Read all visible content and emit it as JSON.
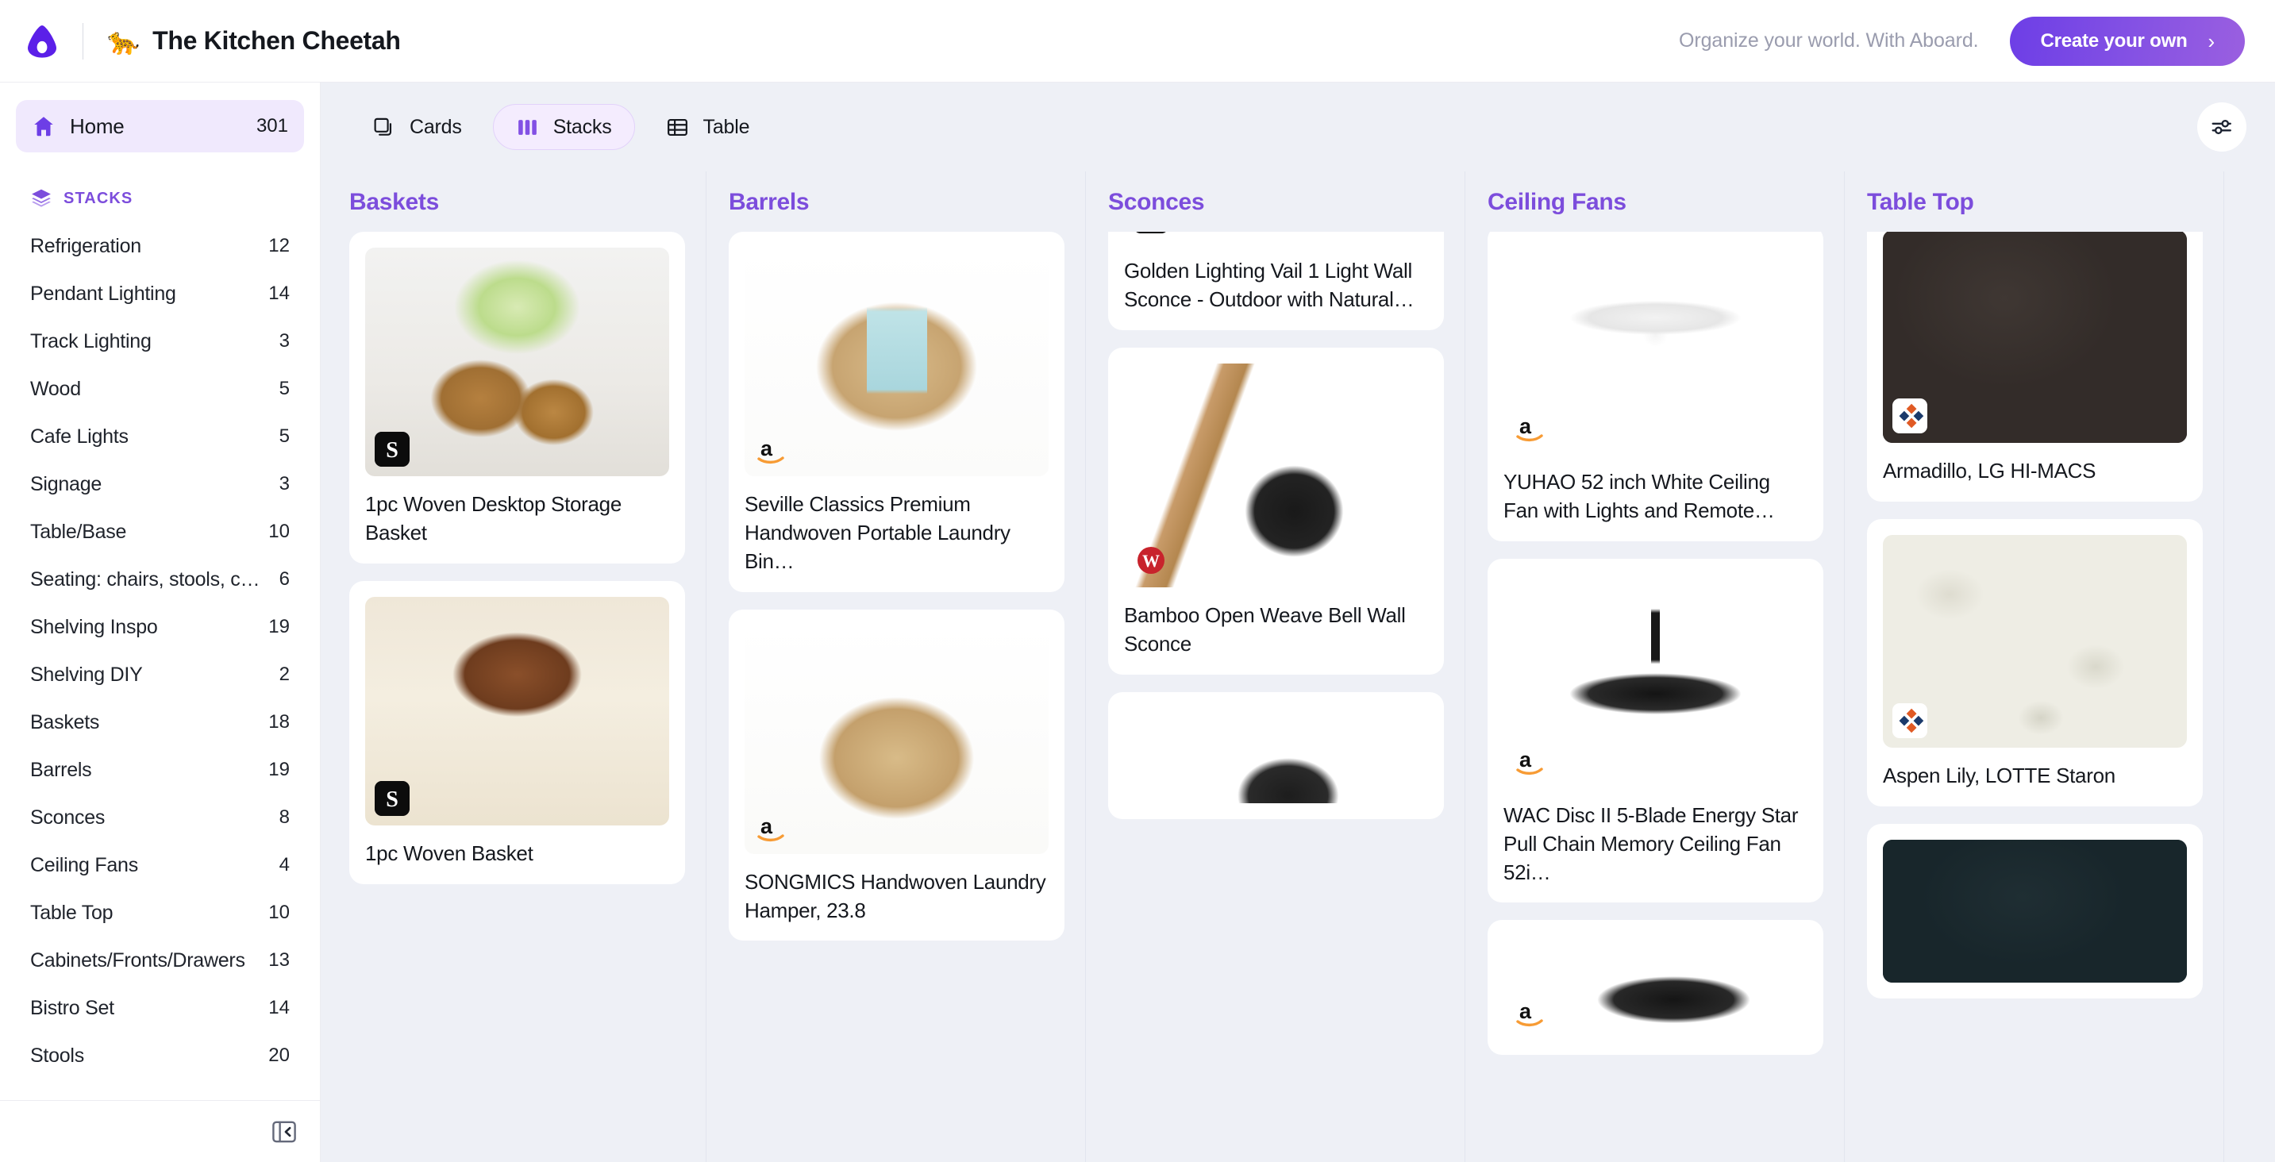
{
  "header": {
    "logo_icon": "aboard-logo-icon",
    "board_emoji": "🐆",
    "board_title": "The Kitchen Cheetah",
    "tagline": "Organize your world. With Aboard.",
    "cta_label": "Create your own",
    "cta_chevron": "›",
    "cta_color": "#8250e4"
  },
  "sidebar": {
    "home": {
      "label": "Home",
      "count": "301",
      "icon": "home-icon"
    },
    "section": {
      "label": "STACKS",
      "icon": "stacks-layers-icon",
      "color": "#7c4ddc"
    },
    "items": [
      {
        "label": "Refrigeration",
        "count": "12"
      },
      {
        "label": "Pendant Lighting",
        "count": "14"
      },
      {
        "label": "Track Lighting",
        "count": "3"
      },
      {
        "label": "Wood",
        "count": "5"
      },
      {
        "label": "Cafe Lights",
        "count": "5"
      },
      {
        "label": "Signage",
        "count": "3"
      },
      {
        "label": "Table/Base",
        "count": "10"
      },
      {
        "label": "Seating: chairs, stools, ch…",
        "count": "6"
      },
      {
        "label": "Shelving Inspo",
        "count": "19"
      },
      {
        "label": "Shelving DIY",
        "count": "2"
      },
      {
        "label": "Baskets",
        "count": "18"
      },
      {
        "label": "Barrels",
        "count": "19"
      },
      {
        "label": "Sconces",
        "count": "8"
      },
      {
        "label": "Ceiling Fans",
        "count": "4"
      },
      {
        "label": "Table Top",
        "count": "10"
      },
      {
        "label": "Cabinets/Fronts/Drawers",
        "count": "13"
      },
      {
        "label": "Bistro Set",
        "count": "14"
      },
      {
        "label": "Stools",
        "count": "20"
      }
    ],
    "collapse_icon": "panel-collapse-left-icon"
  },
  "toolbar": {
    "tabs": [
      {
        "label": "Cards",
        "icon": "cards-icon",
        "active": false
      },
      {
        "label": "Stacks",
        "icon": "stacks-columns-icon",
        "active": true
      },
      {
        "label": "Table",
        "icon": "table-grid-icon",
        "active": false
      }
    ],
    "settings_icon": "sliders-icon"
  },
  "stacks": [
    {
      "title": "Baskets",
      "cards": [
        {
          "title": "1pc Woven Desktop Storage Basket",
          "badge": "shein",
          "badge_text": "S",
          "photo": "ph-baskets1"
        },
        {
          "title": "1pc Woven Basket",
          "badge": "shein",
          "badge_text": "S",
          "photo": "ph-baskets2"
        }
      ]
    },
    {
      "title": "Barrels",
      "cards": [
        {
          "title": "Seville Classics Premium Handwoven Portable Laundry Bin…",
          "badge": "amazon",
          "badge_text": "a",
          "photo": "ph-barrels1"
        },
        {
          "title": "SONGMICS Handwoven Laundry Hamper, 23.8",
          "badge": "amazon",
          "badge_text": "a",
          "photo": "ph-barrels2"
        }
      ]
    },
    {
      "title": "Sconces",
      "cards": [
        {
          "title": "Golden Lighting Vail 1 Light Wall Sconce - Outdoor with Natural…",
          "badge": "lumens",
          "badge_text": "L+",
          "photo": "ph-sconce0"
        },
        {
          "title": "Bamboo Open Weave Bell Wall Sconce",
          "badge": "worldmarket",
          "badge_text": "W",
          "photo": "ph-sconce1"
        },
        {
          "title": "",
          "badge": "",
          "badge_text": "",
          "photo": "ph-sconce2"
        }
      ]
    },
    {
      "title": "Ceiling Fans",
      "cards": [
        {
          "title": "YUHAO 52 inch White Ceiling Fan with Lights and Remote…",
          "badge": "amazon",
          "badge_text": "a",
          "photo": "ph-fan1"
        },
        {
          "title": "WAC Disc II 5-Blade Energy Star Pull Chain Memory Ceiling Fan 52i…",
          "badge": "amazon",
          "badge_text": "a",
          "photo": "ph-fan2"
        },
        {
          "title": "",
          "badge": "amazon",
          "badge_text": "a",
          "photo": "ph-fan3"
        }
      ]
    },
    {
      "title": "Table Top",
      "cards": [
        {
          "title": "Armadillo, LG HI-MACS",
          "badge": "lg",
          "badge_text": "",
          "photo": "ph-tt1"
        },
        {
          "title": "Aspen Lily, LOTTE Staron",
          "badge": "lg",
          "badge_text": "",
          "photo": "ph-tt2"
        },
        {
          "title": "",
          "badge": "",
          "badge_text": "",
          "photo": "ph-tt3"
        }
      ]
    }
  ]
}
